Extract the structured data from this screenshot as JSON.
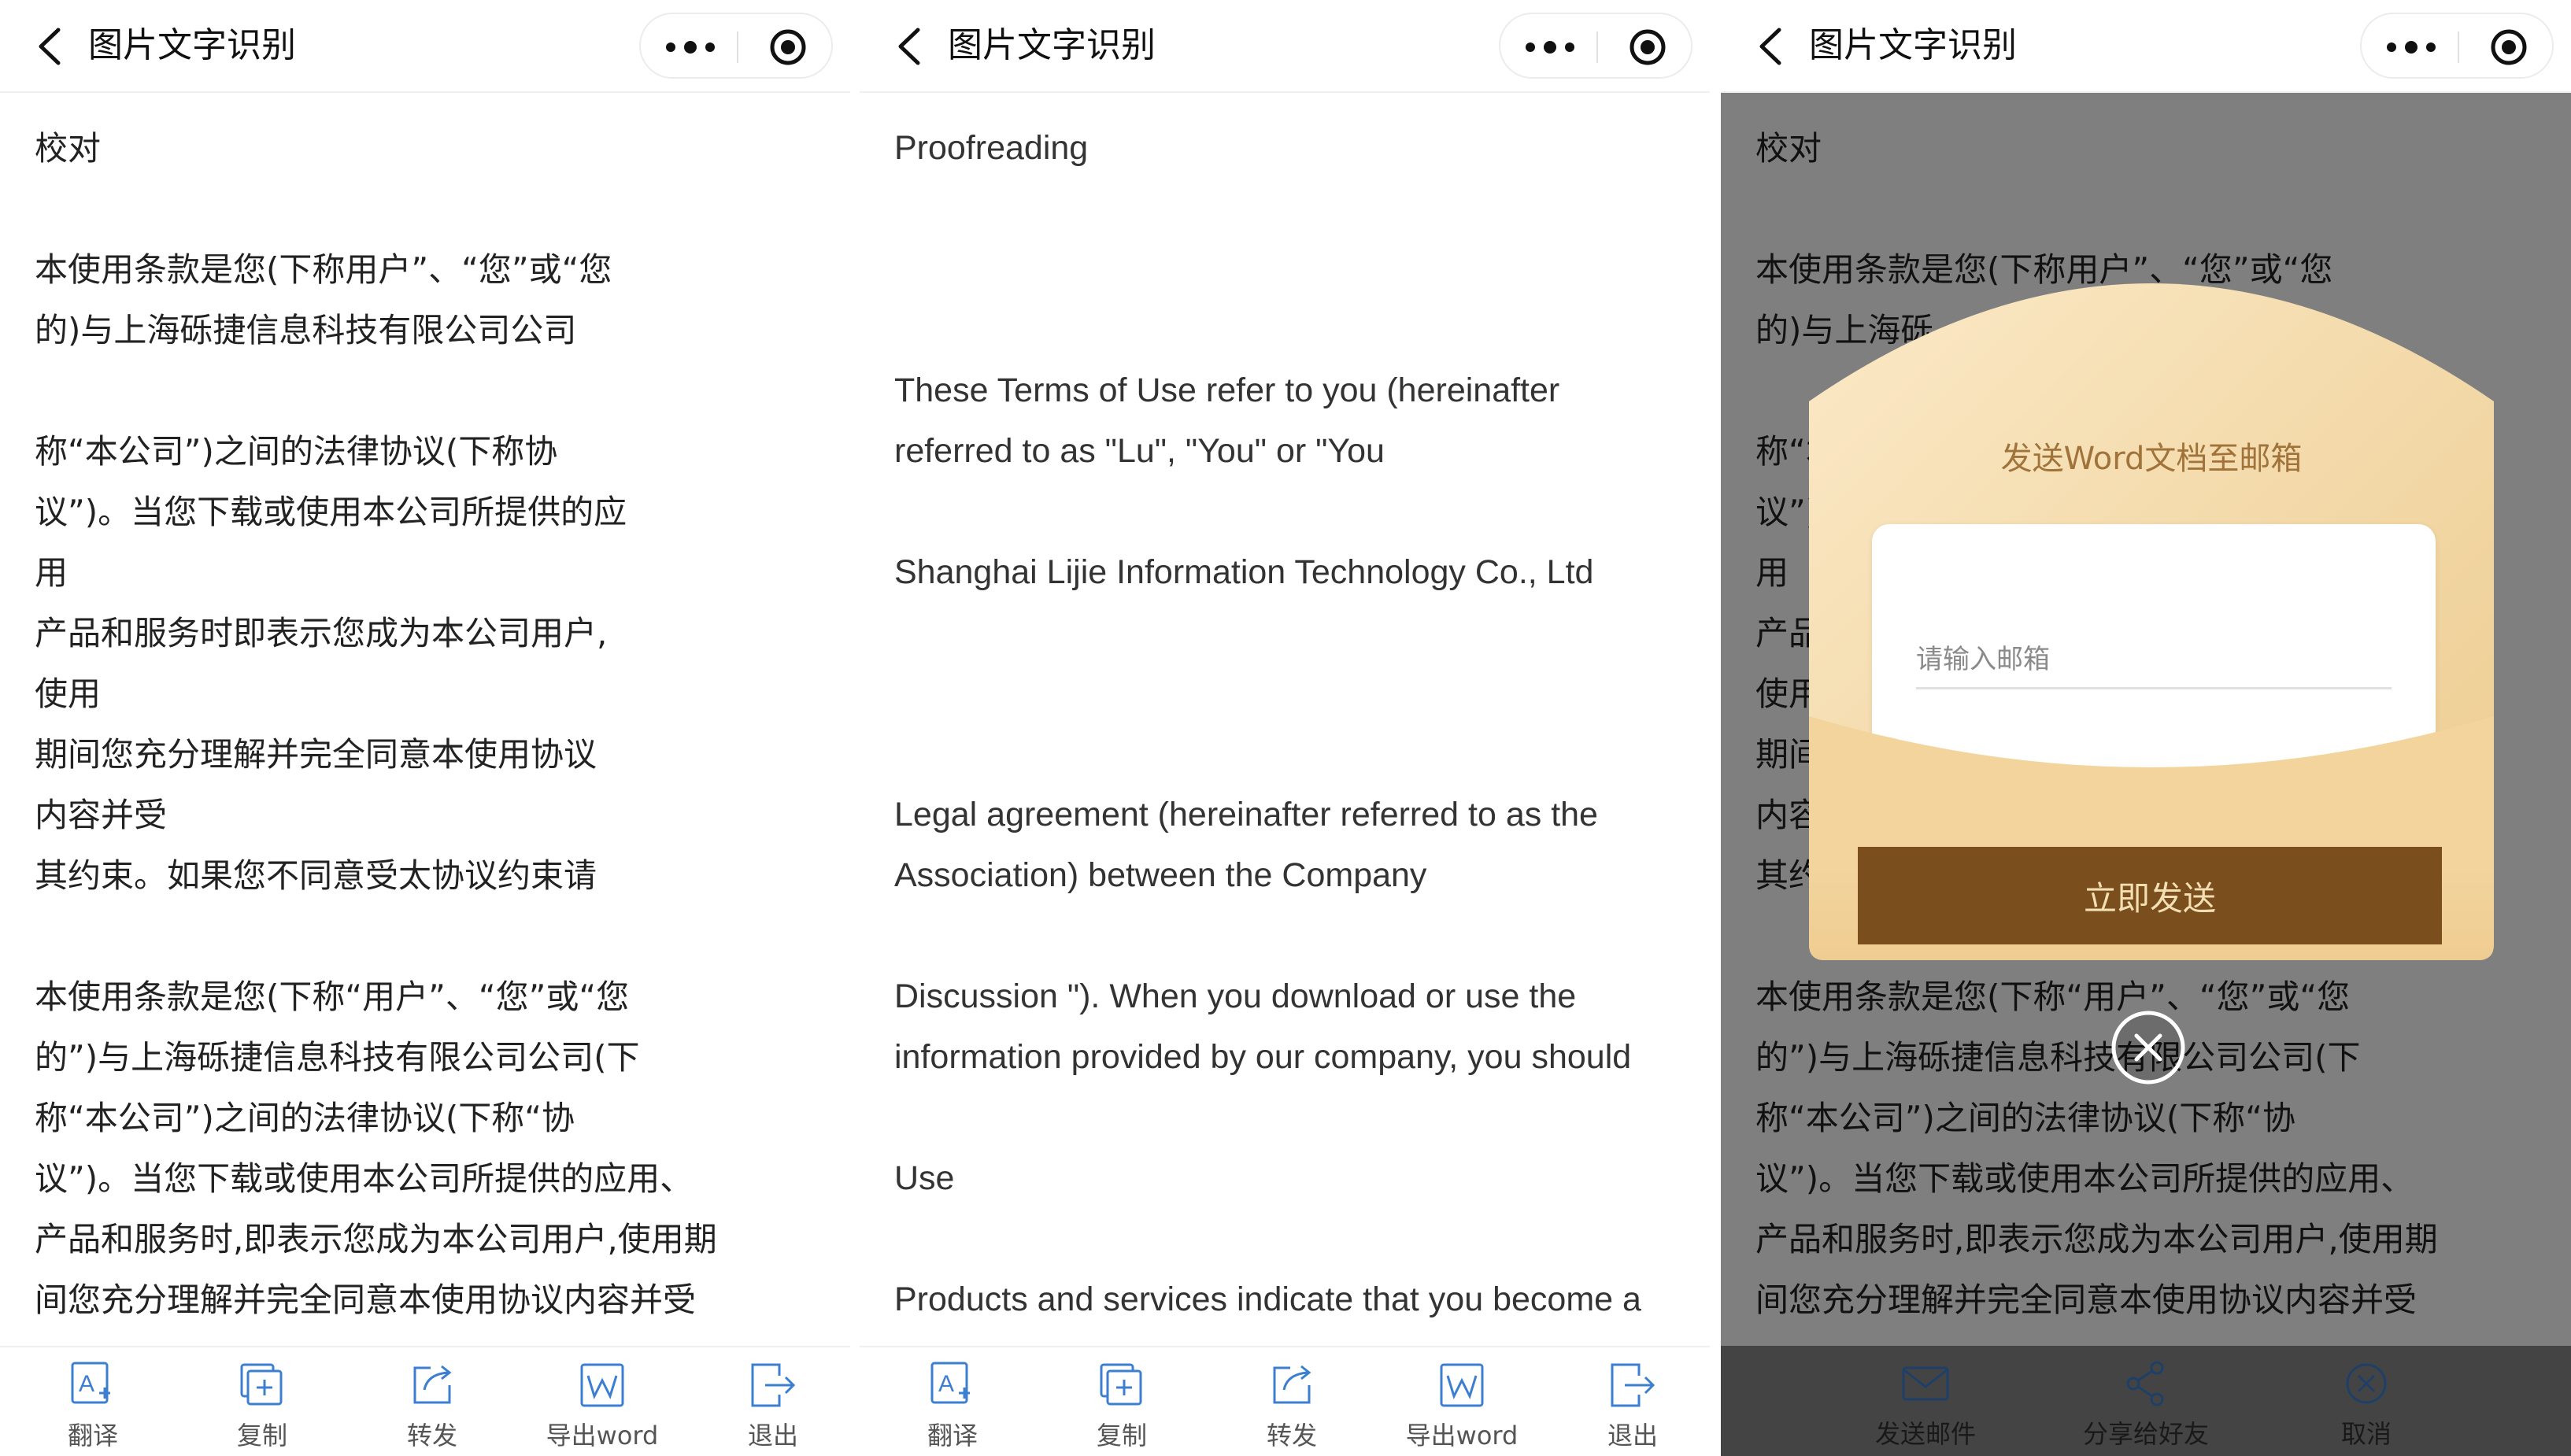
{
  "panels": [
    {
      "title": "图片文字识别",
      "lines": [
        "校对",
        "",
        "本使用条款是您(下称用户”、“您”或“您",
        "的)与上海砾捷信息科技有限公司公司",
        "",
        "称“本公司”)之间的法律协议(下称协",
        "议”)。当您下载或使用本公司所提供的应",
        "用",
        "产品和服务时即表示您成为本公司用户,",
        "使用",
        "期间您充分理解并完全同意本使用协议",
        "内容并受",
        "其约束。如果您不同意受太协议约束请",
        "",
        "本使用条款是您(下称“用户”、“您”或“您",
        "的”)与上海砾捷信息科技有限公司公司(下",
        "称“本公司”)之间的法律协议(下称“协",
        "议”)。当您下载或使用本公司所提供的应用、",
        "产品和服务时,即表示您成为本公司用户,使用期",
        "间您充分理解并完全同意本使用协议内容并受"
      ],
      "toolbar": [
        "翻译",
        "复制",
        "转发",
        "导出word",
        "退出"
      ]
    },
    {
      "title": "图片文字识别",
      "lines": [
        "Proofreading",
        "",
        "",
        "",
        "These Terms of Use refer to you (hereinafter",
        "referred to as \"Lu\", \"You\" or \"You",
        "",
        "Shanghai Lijie Information Technology Co., Ltd",
        "",
        "",
        "",
        "Legal agreement (hereinafter referred to as the",
        "Association) between the Company",
        "",
        "Discussion \"). When you download or use the",
        "information provided by our company, you should",
        "",
        "Use",
        "",
        "Products and services indicate that you become a"
      ],
      "toolbar": [
        "翻译",
        "复制",
        "转发",
        "导出word",
        "退出"
      ]
    },
    {
      "title": "图片文字识别",
      "lines": [
        "校对",
        "",
        "本使用条款是您(下称用户”、“您”或“您",
        "的)与上海砾",
        "",
        "称“本",
        "议”)",
        "用",
        "产品",
        "使用",
        "期间",
        "内容",
        "其约",
        "",
        "本使用条款是您(下称“用户”、“您”或“您",
        "的”)与上海砾捷信息科技有限公司公司(下",
        "称“本公司”)之间的法律协议(下称“协",
        "议”)。当您下载或使用本公司所提供的应用、",
        "产品和服务时,即表示您成为本公司用户,使用期",
        "间您充分理解并完全同意本使用协议内容并受"
      ],
      "toolbar": [
        "发送邮件",
        "分享给好友",
        "取消"
      ]
    }
  ],
  "dialog": {
    "title": "发送Word文档至邮箱",
    "email_placeholder": "请输入邮箱",
    "send_label": "立即发送"
  },
  "colors": {
    "envelope_light": "#f9e6c0",
    "envelope_dark": "#efcf95",
    "title_gold": "#a0733a",
    "button_brown": "#7a4e1d",
    "icon_blue": "#3c7fd0"
  }
}
